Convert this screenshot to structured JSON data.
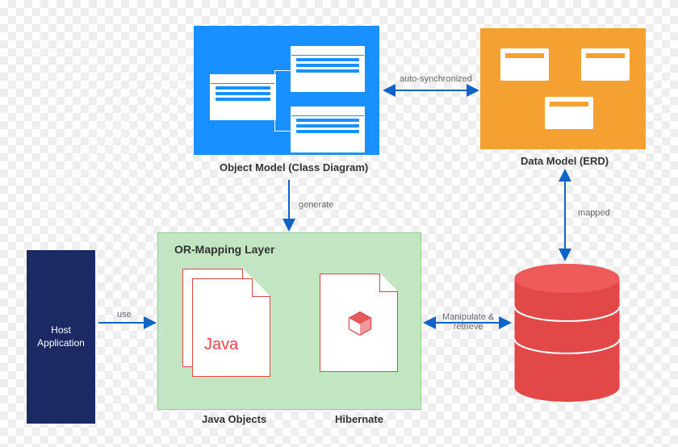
{
  "object_model": {
    "caption": "Object Model (Class Diagram)"
  },
  "data_model": {
    "caption": "Data Model (ERD)"
  },
  "or_mapping": {
    "title": "OR-Mapping Layer",
    "java_label": "Java",
    "java_caption": "Java Objects",
    "hibernate_caption": "Hibernate"
  },
  "host_app": {
    "label": "Host\nApplication"
  },
  "arrows": {
    "auto_sync": "auto-synchronized",
    "generate": "generate",
    "mapped": "mapped",
    "use": "use",
    "manipulate": "Manipulate &\nretrieve"
  }
}
